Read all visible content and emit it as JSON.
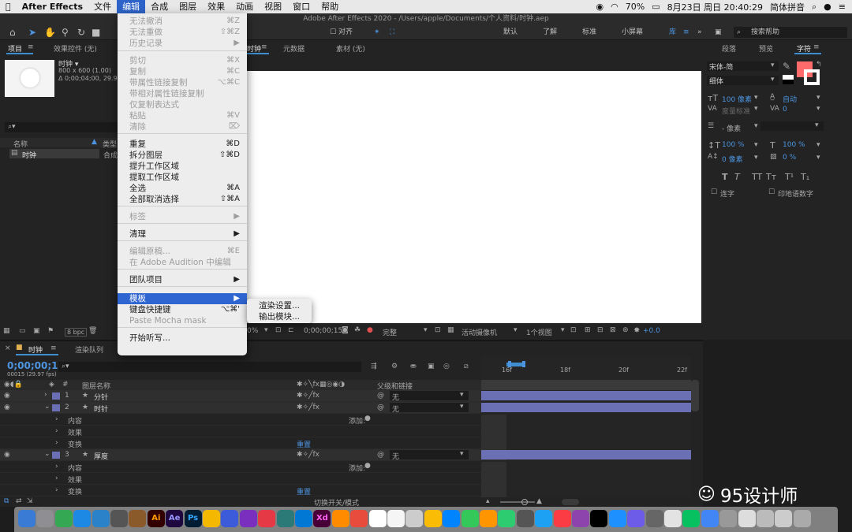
{
  "menubar": {
    "app": "After Effects",
    "items": [
      "文件",
      "编辑",
      "合成",
      "图层",
      "效果",
      "动画",
      "视图",
      "窗口",
      "帮助"
    ],
    "battery": "70%",
    "datetime": "8月23日 周日  20:40:29",
    "ime": "简体拼音"
  },
  "titlebar": {
    "title": "Adobe After Effects 2020 - /Users/apple/Documents/个人资料/时钟.aep"
  },
  "toolbar": {
    "align": "对齐",
    "workspaces": [
      "默认",
      "了解",
      "标准",
      "小屏幕",
      "库"
    ],
    "search_placeholder": "搜索帮助"
  },
  "project": {
    "tab": "项目",
    "effects_tab": "效果控件 (无)",
    "item_name": "时钟 ▾",
    "item_size": "800 x 600 (1.00)",
    "item_duration": "Δ 0;00;04;00, 29.97 fps",
    "col_name": "名称",
    "col_type": "类型",
    "row_name": "时钟",
    "row_type": "合成",
    "bpc": "8 bpc"
  },
  "viewer": {
    "tab": "时钟",
    "tab2": "元数据",
    "tab3": "素材 (无)",
    "zoom": "0%",
    "timecode": "0;00;00;15",
    "quality": "完整",
    "camera": "活动摄像机",
    "views": "1个视图",
    "exposure": "+0.0"
  },
  "character": {
    "tabs": [
      "段落",
      "预览",
      "字符"
    ],
    "font": "宋体-简",
    "style": "细体",
    "size": "100 像素",
    "leading": "自动",
    "tracking_label": "度量标准",
    "kerning": "0",
    "stroke": "- 像素",
    "vscale": "100 %",
    "hscale": "100 %",
    "baseline": "0 像素",
    "tsume": "0 %",
    "ligature": "连字",
    "hindi": "印地语数字",
    "fill_color": "#ff6b6b"
  },
  "editmenu": {
    "items": [
      {
        "label": "无法撤消",
        "sc": "⌘Z",
        "dis": true
      },
      {
        "label": "无法重做",
        "sc": "⇧⌘Z",
        "dis": true
      },
      {
        "label": "历史记录",
        "sc": "▶",
        "dis": true
      },
      {
        "label": "剪切",
        "sc": "⌘X",
        "dis": true
      },
      {
        "label": "复制",
        "sc": "⌘C",
        "dis": true
      },
      {
        "label": "带属性链接复制",
        "sc": "⌥⌘C",
        "dis": true
      },
      {
        "label": "带相对属性链接复制",
        "sc": "",
        "dis": true
      },
      {
        "label": "仅复制表达式",
        "sc": "",
        "dis": true
      },
      {
        "label": "粘贴",
        "sc": "⌘V",
        "dis": true
      },
      {
        "label": "清除",
        "sc": "⌦",
        "dis": true
      },
      {
        "label": "重复",
        "sc": "⌘D",
        "dis": false
      },
      {
        "label": "拆分图层",
        "sc": "⇧⌘D",
        "dis": false
      },
      {
        "label": "提升工作区域",
        "sc": "",
        "dis": false
      },
      {
        "label": "提取工作区域",
        "sc": "",
        "dis": false
      },
      {
        "label": "全选",
        "sc": "⌘A",
        "dis": false
      },
      {
        "label": "全部取消选择",
        "sc": "⇧⌘A",
        "dis": false
      },
      {
        "label": "标签",
        "sc": "▶",
        "dis": true
      },
      {
        "label": "清理",
        "sc": "▶",
        "dis": false
      },
      {
        "label": "编辑原稿...",
        "sc": "⌘E",
        "dis": true
      },
      {
        "label": "在 Adobe Audition 中编辑",
        "sc": "",
        "dis": true
      },
      {
        "label": "团队项目",
        "sc": "▶",
        "dis": false
      },
      {
        "label": "模板",
        "sc": "▶",
        "dis": false
      },
      {
        "label": "键盘快捷键",
        "sc": "⌥⌘'",
        "dis": false
      },
      {
        "label": "Paste Mocha mask",
        "sc": "",
        "dis": true
      },
      {
        "label": "开始听写...",
        "sc": "",
        "dis": false
      }
    ]
  },
  "submenu": {
    "items": [
      "渲染设置...",
      "输出模块..."
    ]
  },
  "timeline": {
    "tab": "时钟",
    "render_tab": "渲染队列",
    "timecode": "0;00;00;15",
    "fps": "00015 (29.97 fps)",
    "col_layer": "图层名称",
    "col_parent": "父级和链接",
    "ruler": [
      "16f",
      "18f",
      "20f",
      "22f"
    ],
    "layers": [
      {
        "num": "1",
        "name": "分针",
        "parent": "无"
      },
      {
        "num": "2",
        "name": "时针",
        "parent": "无"
      },
      {
        "num": "3",
        "name": "厚度",
        "parent": "无"
      }
    ],
    "sub": {
      "content": "内容",
      "effects": "效果",
      "transform": "变换",
      "add": "添加:",
      "reset": "重置"
    },
    "switch_label": "切换开关/模式"
  },
  "watermark": "95设计师"
}
